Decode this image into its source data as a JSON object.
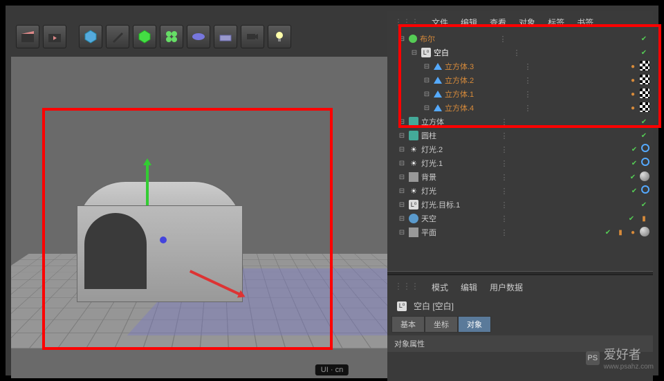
{
  "panel_menu": [
    "文件",
    "编辑",
    "查看",
    "对象",
    "标签",
    "书签"
  ],
  "tree": [
    {
      "indent": 0,
      "icon": "boole",
      "label": "布尔",
      "cls": "orange",
      "tags": [
        "check"
      ]
    },
    {
      "indent": 1,
      "icon": "null",
      "label": "空白",
      "cls": "sel",
      "tags": [
        "check"
      ]
    },
    {
      "indent": 2,
      "icon": "cone",
      "label": "立方体.3",
      "cls": "orange",
      "tags": [
        "dot-o",
        "checker"
      ]
    },
    {
      "indent": 2,
      "icon": "cone",
      "label": "立方体.2",
      "cls": "orange",
      "tags": [
        "dot-o",
        "checker"
      ]
    },
    {
      "indent": 2,
      "icon": "cone",
      "label": "立方体.1",
      "cls": "orange",
      "tags": [
        "dot-o",
        "checker"
      ]
    },
    {
      "indent": 2,
      "icon": "cone",
      "label": "立方体.4",
      "cls": "orange",
      "tags": [
        "dot-o",
        "checker"
      ]
    },
    {
      "indent": 0,
      "icon": "cube",
      "label": "立方体",
      "cls": "",
      "tags": [
        "check"
      ]
    },
    {
      "indent": 0,
      "icon": "cube",
      "label": "圆柱",
      "cls": "",
      "tags": [
        "check"
      ]
    },
    {
      "indent": 0,
      "icon": "light",
      "label": "灯光.2",
      "cls": "",
      "tags": [
        "check",
        "ring"
      ]
    },
    {
      "indent": 0,
      "icon": "light",
      "label": "灯光.1",
      "cls": "",
      "tags": [
        "check",
        "ring"
      ]
    },
    {
      "indent": 0,
      "icon": "plane",
      "label": "背景",
      "cls": "",
      "tags": [
        "check",
        "sphere"
      ]
    },
    {
      "indent": 0,
      "icon": "light",
      "label": "灯光",
      "cls": "",
      "tags": [
        "check",
        "ring"
      ]
    },
    {
      "indent": 0,
      "icon": "null",
      "label": "灯光.目标.1",
      "cls": "",
      "tags": [
        "check"
      ]
    },
    {
      "indent": 0,
      "icon": "sky",
      "label": "天空",
      "cls": "",
      "tags": [
        "check",
        "film"
      ]
    },
    {
      "indent": 0,
      "icon": "plane",
      "label": "平面",
      "cls": "",
      "tags": [
        "check",
        "film",
        "dot-o",
        "sphere"
      ]
    }
  ],
  "attr_menu": [
    "模式",
    "编辑",
    "用户数据"
  ],
  "attr_title": "空白 [空白]",
  "attr_tabs": [
    "基本",
    "坐标",
    "对象"
  ],
  "attr_section": "对象属性",
  "watermark_text": "爱好者",
  "watermark_url": "www.psahz.com",
  "ui_cn": "UI · cn"
}
